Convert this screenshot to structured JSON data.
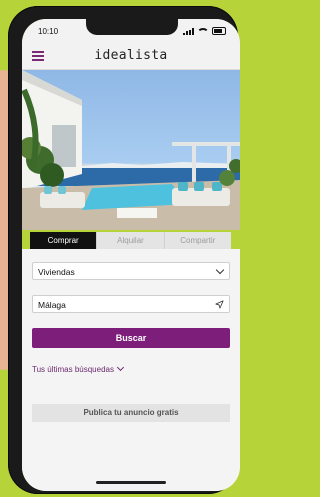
{
  "status": {
    "time": "10:10"
  },
  "header": {
    "logo": "idealista"
  },
  "tabs": [
    {
      "label": "Comprar",
      "active": true
    },
    {
      "label": "Alquilar",
      "active": false
    },
    {
      "label": "Compartir",
      "active": false
    }
  ],
  "form": {
    "property_type": "Viviendas",
    "location": "Málaga",
    "search_label": "Buscar",
    "recent_searches": "Tus últimas búsquedas",
    "publish_label": "Publica tu anuncio gratis"
  },
  "colors": {
    "accent": "#7d1f7a",
    "background": "#b6d33a"
  }
}
